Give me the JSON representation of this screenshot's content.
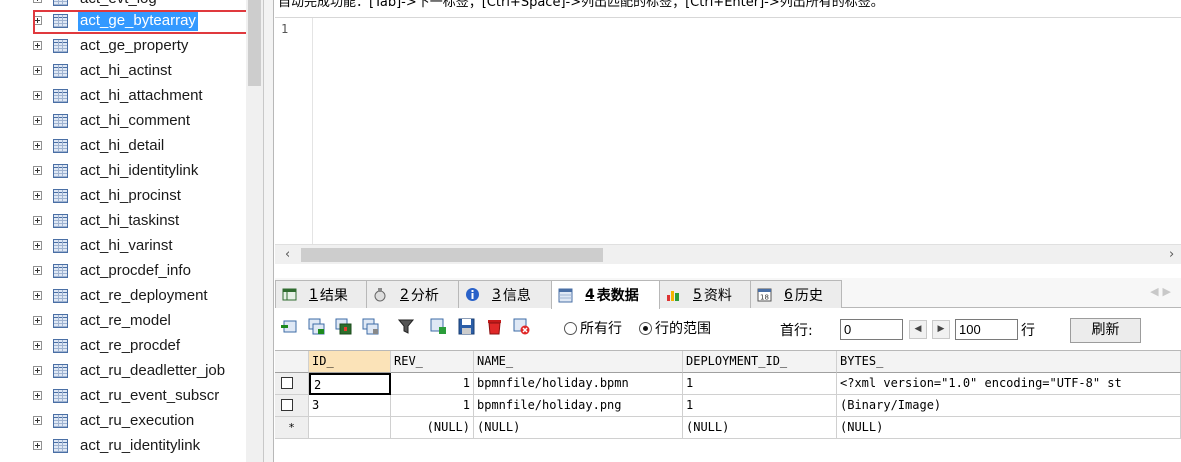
{
  "hint_text": "自动完成功能：[Tab]->下一标签；[Ctrl+Space]->列出匹配的标签；[Ctrl+Enter]->列出所有的标签。",
  "tree": {
    "partial_top": "act_evt_log",
    "selected": "act_ge_bytearray",
    "items": [
      "act_ge_bytearray",
      "act_ge_property",
      "act_hi_actinst",
      "act_hi_attachment",
      "act_hi_comment",
      "act_hi_detail",
      "act_hi_identitylink",
      "act_hi_procinst",
      "act_hi_taskinst",
      "act_hi_varinst",
      "act_procdef_info",
      "act_re_deployment",
      "act_re_model",
      "act_re_procdef",
      "act_ru_deadletter_job",
      "act_ru_event_subscr",
      "act_ru_execution",
      "act_ru_identitylink"
    ]
  },
  "editor": {
    "line_number": "1"
  },
  "tabs": [
    {
      "num": "1",
      "label": "结果",
      "icon": "grid-result-icon"
    },
    {
      "num": "2",
      "label": "分析",
      "icon": "profiler-icon"
    },
    {
      "num": "3",
      "label": "信息",
      "icon": "info-icon"
    },
    {
      "num": "4",
      "label": "表数据",
      "icon": "table-data-icon",
      "active": true
    },
    {
      "num": "5",
      "label": "资料",
      "icon": "info-chart-icon"
    },
    {
      "num": "6",
      "label": "历史",
      "icon": "calendar-icon"
    }
  ],
  "toolbar": {
    "radio_all": "所有行",
    "radio_range": "行的范围",
    "radio_selected": "range",
    "first_row_label": "首行:",
    "first_row_value": "0",
    "rows_value": "100",
    "rows_label": "行",
    "refresh_label": "刷新"
  },
  "grid": {
    "columns": [
      "ID_",
      "REV_",
      "NAME_",
      "DEPLOYMENT_ID_",
      "BYTES_"
    ],
    "rows": [
      {
        "id": "2",
        "rev": "1",
        "name": "bpmnfile/holiday.bpmn",
        "deployment_id": "1",
        "bytes": "<?xml version=\"1.0\" encoding=\"UTF-8\" st"
      },
      {
        "id": "3",
        "rev": "1",
        "name": "bpmnfile/holiday.png",
        "deployment_id": "1",
        "bytes": "(Binary/Image)"
      }
    ],
    "new_row": {
      "marker": "*",
      "rev": "(NULL)",
      "name": "(NULL)",
      "deployment_id": "(NULL)",
      "bytes": "(NULL)"
    }
  }
}
